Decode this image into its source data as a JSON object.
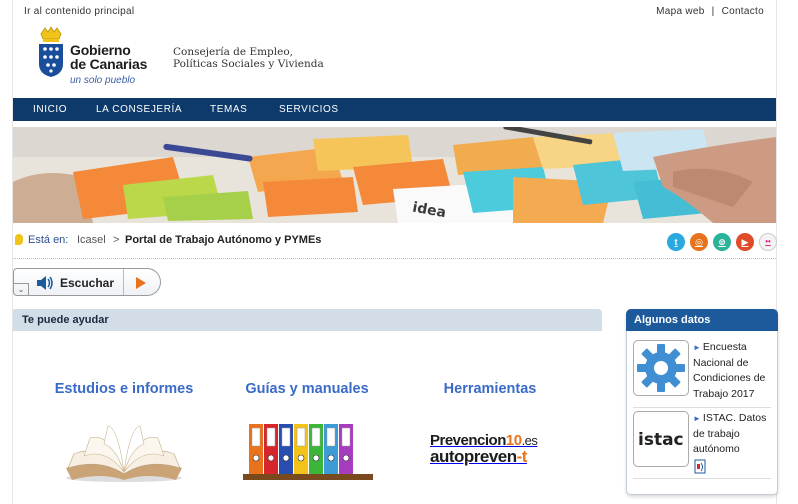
{
  "top": {
    "skip_link": "Ir al contenido principal",
    "sitemap": "Mapa web",
    "separator": "|",
    "contact": "Contacto"
  },
  "logo": {
    "line1": "Gobierno",
    "line2": "de Canarias",
    "motto": "un solo pueblo"
  },
  "department": {
    "line1": "Consejería de Empleo,",
    "line2": "Políticas Sociales y Vivienda"
  },
  "nav": {
    "items": [
      "INICIO",
      "LA CONSEJERÍA",
      "TEMAS",
      "SERVICIOS"
    ]
  },
  "breadcrumb": {
    "label": "Está en:",
    "items": [
      "Icasel",
      "Portal de Trabajo Autónomo y PYMEs"
    ],
    "separator": ">"
  },
  "social": [
    {
      "icon": "twitter-icon",
      "color": "#2aa9e0",
      "glyph": "t"
    },
    {
      "icon": "instagram-icon",
      "color": "#e8731c",
      "glyph": "◎"
    },
    {
      "icon": "flickr-alt-icon",
      "color": "#2bb39a",
      "glyph": "⊚"
    },
    {
      "icon": "youtube-icon",
      "color": "#e04b2a",
      "glyph": "▶"
    },
    {
      "icon": "flickr-icon",
      "color": "#f4f4f4",
      "glyph": "••"
    }
  ],
  "listen": {
    "label": "Escuchar",
    "dropdown_glyph": "⌄"
  },
  "help": {
    "title": "Te puede ayudar",
    "columns": [
      {
        "title": "Estudios e informes",
        "image": "open-book-image"
      },
      {
        "title": "Guías y manuales",
        "image": "binders-image"
      },
      {
        "title": "Herramientas",
        "image": "prevencion10-logo"
      }
    ],
    "prevencion": {
      "brand1": "Prevencion",
      "brand1_num": "10",
      "brand1_tld": ".es",
      "brand2": "autopreven",
      "brand2_suffix": "-t"
    }
  },
  "sidebar": {
    "title": "Algunos datos",
    "items": [
      {
        "text": "Encuesta Nacional de Condiciones de Trabajo 2017",
        "icon": "gear-icon"
      },
      {
        "text": "ISTAC. Datos de trabajo autónomo",
        "logo": "istac",
        "badge": "document-icon"
      }
    ]
  },
  "colors": {
    "nav_bg": "#0e3a6b",
    "link_blue": "#3a6bc8",
    "accent_orange": "#e8731c",
    "sidebar_head": "#1d5a9c"
  }
}
